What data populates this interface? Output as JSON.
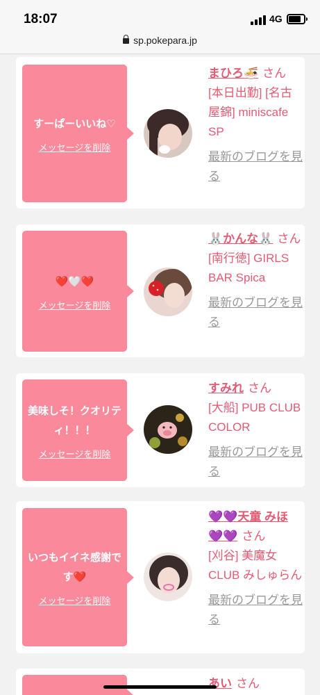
{
  "status_bar": {
    "time": "18:07",
    "network": "4G",
    "url": "sp.pokepara.jp"
  },
  "delete_label": "メッセージを削除",
  "blog_label": "最新のブログを見る",
  "san_label": "さん",
  "cards": [
    {
      "message": "すーぱーいいね♡",
      "name": "まひろ🍜",
      "shop": "[本日出勤] [名古屋錦] miniscafe SP"
    },
    {
      "message": "❤️🤍❤️",
      "name": "🐰かんな🐰",
      "shop": "[南行徳] GIRLS BAR Spica"
    },
    {
      "message": "美味しそ！クオリティ！！！",
      "name": "すみれ",
      "shop": "[大船] PUB CLUB COLOR"
    },
    {
      "message": "いつもイイネ感謝です❤️",
      "name": "💜💜天童 みほ💜💜",
      "shop": "[刈谷] 美魔女CLUB みしゅらん"
    },
    {
      "name": "あい"
    }
  ],
  "colors": {
    "bubble": "#fa8a9b",
    "accent": "#e35b73",
    "link_gray": "#999999"
  },
  "icons": [
    "signal-icon",
    "battery-icon",
    "lock-icon"
  ]
}
